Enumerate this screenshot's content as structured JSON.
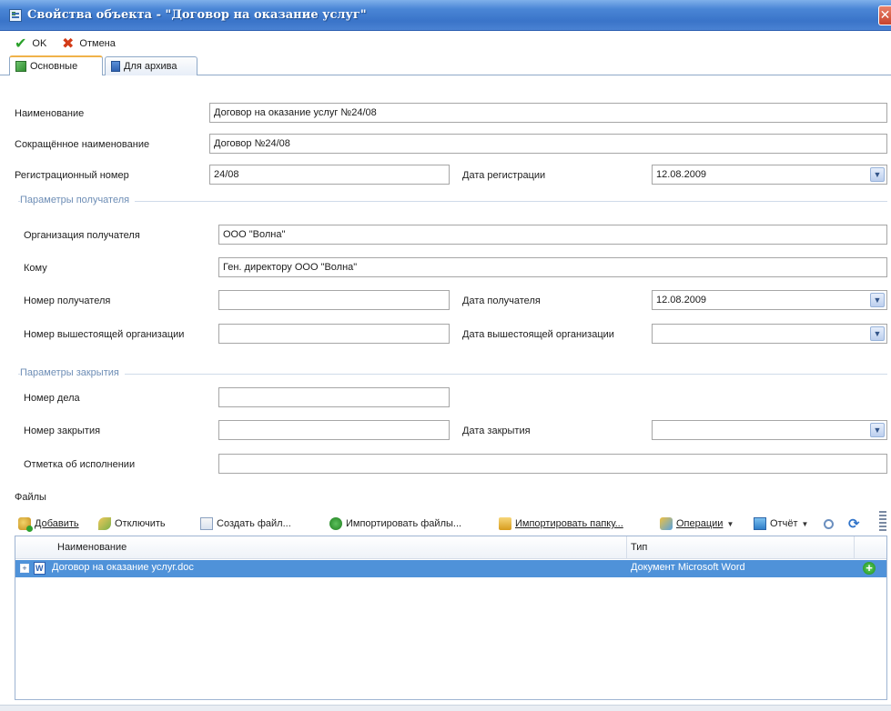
{
  "window": {
    "title": "Свойства объекта - \"Договор на оказание услуг\"",
    "close_glyph": "✕"
  },
  "actions": {
    "ok_label": "OK",
    "cancel_label": "Отмена"
  },
  "tabs": [
    {
      "label": "Основные",
      "active": true
    },
    {
      "label": "Для архива",
      "active": false
    }
  ],
  "form": {
    "name": {
      "label": "Наименование",
      "value": "Договор на оказание услуг №24/08"
    },
    "short_name": {
      "label": "Сокращённое наименование",
      "value": "Договор №24/08"
    },
    "reg_number": {
      "label": "Регистрационный номер",
      "value": "24/08"
    },
    "reg_date": {
      "label": "Дата регистрации",
      "value": "12.08.2009"
    }
  },
  "recipient": {
    "group_title": "Параметры получателя",
    "org": {
      "label": "Организация получателя",
      "value": "ООО \"Волна\""
    },
    "to_whom": {
      "label": "Кому",
      "value": "Ген. директору ООО \"Волна\""
    },
    "recipient_number": {
      "label": "Номер получателя",
      "value": ""
    },
    "recipient_date": {
      "label": "Дата получателя",
      "value": "12.08.2009"
    },
    "higher_org_number": {
      "label": "Номер вышестоящей организации",
      "value": ""
    },
    "higher_org_date": {
      "label": "Дата вышестоящей организации",
      "value": ""
    }
  },
  "closing": {
    "group_title": "Параметры закрытия",
    "case_number": {
      "label": "Номер дела",
      "value": ""
    },
    "closing_number": {
      "label": "Номер закрытия",
      "value": ""
    },
    "closing_date": {
      "label": "Дата закрытия",
      "value": ""
    },
    "execution_mark": {
      "label": "Отметка об исполнении",
      "value": ""
    }
  },
  "files": {
    "title": "Файлы",
    "toolbar": {
      "add": "Добавить",
      "detach": "Отключить",
      "create": "Создать файл...",
      "import_files": "Импортировать файлы...",
      "import_folder": "Импортировать папку...",
      "operations": "Операции",
      "report": "Отчёт"
    },
    "columns": [
      "Наименование",
      "Тип"
    ],
    "rows": [
      {
        "name": "Договор на оказание услуг.doc",
        "type": "Документ Microsoft Word"
      }
    ]
  },
  "colors": {
    "titlebar": "#3a74c9",
    "selection": "#4f92d9",
    "group_title": "#6e8eb6"
  }
}
